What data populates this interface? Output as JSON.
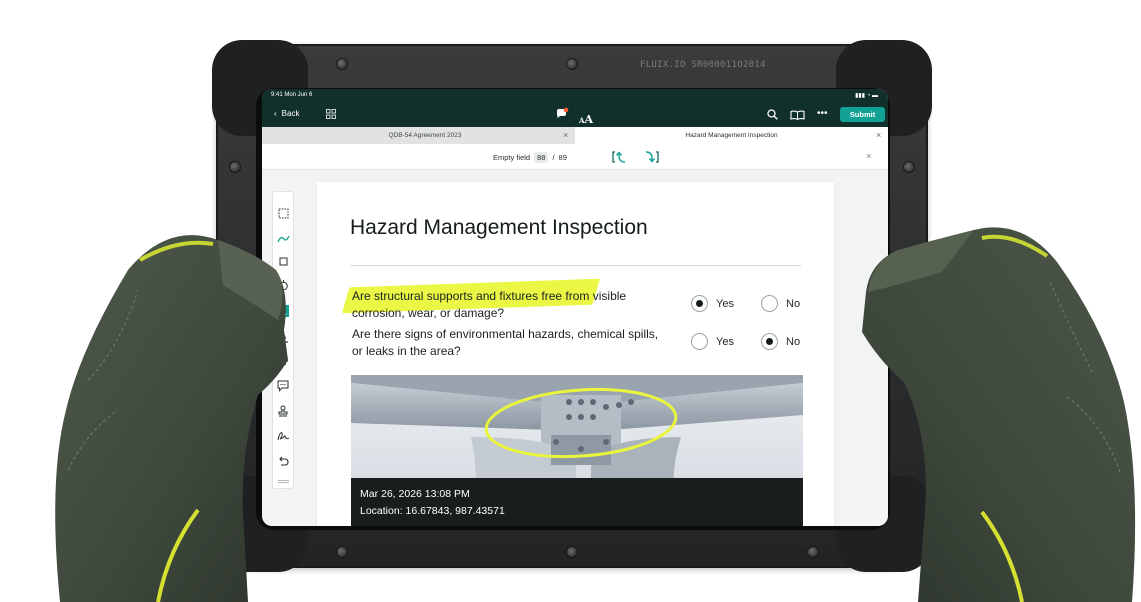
{
  "device": {
    "serial": "FLUIX.IO SR000011O2014"
  },
  "status_bar": {
    "time": "9:41  Mon Jun 6",
    "icons": "▮▮▮  ◔  ▬"
  },
  "appbar": {
    "back_label": "Back",
    "submit_label": "Submit",
    "more_label": "•••",
    "text_size_small": "A",
    "text_size_big": "A",
    "accent_color": "#13a095",
    "bar_color": "#11302c"
  },
  "tabs": [
    {
      "label": "QDB-54 Agreement 2023",
      "active": false
    },
    {
      "label": "Hazard Management Inspection",
      "active": true
    }
  ],
  "tab_close": "×",
  "field_nav": {
    "label": "Empty field",
    "current": "88",
    "separator": "/",
    "total": "89"
  },
  "toolbar": {
    "tools": [
      "select-icon",
      "pen-icon",
      "crop-icon",
      "lasso-icon",
      "text-box-icon",
      "underline-icon",
      "strikethrough-icon",
      "comment-icon",
      "stamp-icon",
      "signature-icon",
      "undo-icon"
    ]
  },
  "document": {
    "title": "Hazard Management Inspection",
    "questions": [
      {
        "text": "Are structural supports and fixtures free from visible corrosion, wear, or damage?",
        "answer": "Yes"
      },
      {
        "text": "Are there signs of environmental hazards, chemical spills, or leaks in the area?",
        "answer": "No"
      }
    ],
    "option_yes": "Yes",
    "option_no": "No",
    "highlight_color": "#e9f73a",
    "photo": {
      "datetime": "Mar 26, 2026 13:08 PM",
      "location": "Location: 16.67843, 987.43571",
      "annotation_color": "#e8f53c"
    }
  }
}
